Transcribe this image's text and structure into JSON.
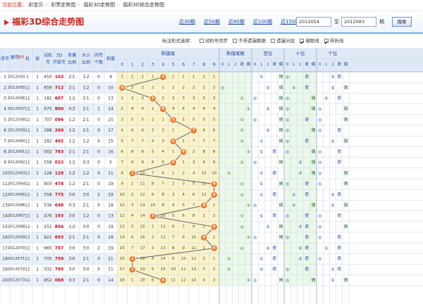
{
  "breadcrumb": {
    "label": "当前位置：",
    "items": [
      "彩宝贝",
      "彩票走势图",
      "福彩3D走势图",
      "福彩3D综合走势图"
    ]
  },
  "title": "福彩3D综合走势图",
  "periods": [
    "近30期",
    "近50期",
    "近80期",
    "近100期",
    "近150期"
  ],
  "range": {
    "from": "2012054",
    "to": "2012083",
    "to_label": "至",
    "qi_label": "期",
    "search": "搜索"
  },
  "options": {
    "label": "标注形式选择：",
    "items": [
      {
        "label": "试机号同步",
        "checked": false
      },
      {
        "label": "不带遗漏数据",
        "checked": false
      },
      {
        "label": "遗漏分层",
        "checked": false
      },
      {
        "label": "辅助线",
        "checked": true
      },
      {
        "label": "带折线",
        "checked": true
      }
    ]
  },
  "headers": {
    "seq": "序号",
    "period": "期号",
    "sort": "排序",
    "machine": "机",
    "ball": "球",
    "trial": "试机号",
    "prize": "3D开奖号",
    "oddeven": "奇偶比例",
    "bigsmall": "大小比例",
    "same": "同号个数",
    "sum": "和值",
    "sec_sumtail": "和值尾",
    "sec_sumtail_sub": "和值尾数",
    "sec_hund": "百位",
    "sec_ten": "十位",
    "sec_unit": "个位",
    "odd": "奇",
    "even": "偶"
  },
  "digits": [
    "0",
    "1",
    "2",
    "3",
    "4",
    "5",
    "6",
    "7",
    "8",
    "9"
  ],
  "rows": [
    {
      "seq": "1",
      "period": "2012054",
      "m": "1",
      "b": "1",
      "trial": "450",
      "prize": "103",
      "oe": "2∶1",
      "bs": "1∶2",
      "same": "0",
      "sum": "4",
      "tail": 4,
      "miss": [
        "1",
        "1",
        "1",
        "1",
        "",
        "1",
        "1",
        "1",
        "1",
        "1"
      ],
      "tt": "",
      "ht": "①",
      "hp": "偶",
      "tnt": "◎",
      "tp": "奇",
      "ut": "②",
      "up": "奇"
    },
    {
      "seq": "2",
      "period": "2012055",
      "m": "11",
      "b": "1",
      "trial": "659",
      "prize": "712",
      "oe": "2∶1",
      "bs": "1∶2",
      "same": "0",
      "sum": "10",
      "tail": 0,
      "miss": [
        "",
        "2",
        "2",
        "2",
        "1",
        "2",
        "2",
        "2",
        "2",
        "2"
      ],
      "tt": "◎",
      "ht": "②",
      "hp": "偶",
      "tnt": "①",
      "tp": "奇",
      "ut": "②",
      "up": "偶"
    },
    {
      "seq": "3",
      "period": "2012056",
      "m": "11",
      "b": "1",
      "trial": "181",
      "prize": "607",
      "oe": "1∶2",
      "bs": "2∶1",
      "same": "0",
      "sum": "13",
      "tail": 3,
      "miss": [
        "1",
        "3",
        "3",
        "",
        "2",
        "3",
        "3",
        "3",
        "3",
        "3"
      ],
      "tt": "①",
      "ht": "◎",
      "hp": "偶",
      "tnt": "◎",
      "tp": "偶",
      "ut": "①",
      "up": "奇"
    },
    {
      "seq": "4",
      "period": "2012057",
      "m": "11",
      "b": "1",
      "trial": "975",
      "prize": "800",
      "oe": "0∶3",
      "bs": "2∶1",
      "same": "1",
      "sum": "14",
      "tail": 4,
      "miss": [
        "2",
        "4",
        "4",
        "1",
        "",
        "4",
        "4",
        "4",
        "4",
        "4"
      ],
      "tt": "①",
      "ht": "②",
      "hp": "偶",
      "tnt": "◎",
      "tp": "偶",
      "ut": "◎",
      "up": "偶"
    },
    {
      "seq": "5",
      "period": "2012058",
      "m": "11",
      "b": "1",
      "trial": "707",
      "prize": "096",
      "oe": "1∶2",
      "bs": "2∶1",
      "same": "0",
      "sum": "15",
      "tail": 5,
      "miss": [
        "3",
        "5",
        "5",
        "2",
        "1",
        "",
        "5",
        "5",
        "5",
        "5"
      ],
      "tt": "②",
      "ht": "◎",
      "hp": "偶",
      "tnt": "◎",
      "tp": "奇",
      "ut": "◎",
      "up": "偶"
    },
    {
      "seq": "6",
      "period": "2012059",
      "m": "11",
      "b": "1",
      "trial": "288",
      "prize": "269",
      "oe": "1∶2",
      "bs": "2∶1",
      "same": "0",
      "sum": "17",
      "tail": 7,
      "miss": [
        "4",
        "6",
        "6",
        "3",
        "2",
        "1",
        "",
        "6",
        "6",
        "6"
      ],
      "tt": "①",
      "ht": "②",
      "hp": "偶",
      "tnt": "◎",
      "tp": "偶",
      "ut": "◎",
      "up": "奇"
    },
    {
      "seq": "7",
      "period": "2012060",
      "m": "11",
      "b": "1",
      "trial": "282",
      "prize": "492",
      "oe": "1∶2",
      "bs": "1∶2",
      "same": "0",
      "sum": "15",
      "tail": 5,
      "miss": [
        "5",
        "7",
        "7",
        "4",
        "3",
        "",
        "1",
        "7",
        "7",
        "7"
      ],
      "tt": "②",
      "ht": "①",
      "hp": "偶",
      "tnt": "◎",
      "tp": "奇",
      "ut": "②",
      "up": "偶"
    },
    {
      "seq": "8",
      "period": "2012061",
      "m": "11",
      "b": "1",
      "trial": "002",
      "prize": "763",
      "oe": "2∶1",
      "bs": "2∶1",
      "same": "0",
      "sum": "16",
      "tail": 6,
      "miss": [
        "6",
        "8",
        "8",
        "5",
        "4",
        "1",
        "",
        "2",
        "8",
        "8"
      ],
      "tt": "①",
      "ht": "①",
      "hp": "奇",
      "tnt": "◎",
      "tp": "偶",
      "ut": "◎",
      "up": "奇"
    },
    {
      "seq": "9",
      "period": "2012062",
      "m": "11",
      "b": "1",
      "trial": "558",
      "prize": "023",
      "oe": "1∶2",
      "bs": "0∶3",
      "same": "0",
      "sum": "5",
      "tail": 5,
      "miss": [
        "7",
        "9",
        "9",
        "6",
        "5",
        "",
        "1",
        "3",
        "9",
        "9"
      ],
      "tt": "②",
      "ht": "◎",
      "hp": "偶",
      "tnt": "②",
      "tp": "偶",
      "ut": "◎",
      "up": "奇"
    },
    {
      "seq": "10",
      "period": "2012063",
      "m": "11",
      "b": "1",
      "trial": "128",
      "prize": "128",
      "oe": "1∶2",
      "bs": "1∶2",
      "same": "0",
      "sum": "11",
      "tail": 1,
      "miss": [
        "8",
        "",
        "10",
        "7",
        "6",
        "1",
        "2",
        "4",
        "10",
        "10"
      ],
      "tt": "①",
      "ht": "①",
      "hp": "奇",
      "tnt": "②",
      "tp": "偶",
      "ut": "◎",
      "up": "偶"
    },
    {
      "seq": "11",
      "period": "2012064",
      "m": "11",
      "b": "1",
      "trial": "803",
      "prize": "478",
      "oe": "1∶2",
      "bs": "2∶1",
      "same": "0",
      "sum": "19",
      "tail": 9,
      "miss": [
        "9",
        "1",
        "11",
        "8",
        "7",
        "2",
        "3",
        "5",
        "11",
        ""
      ],
      "tt": "◎",
      "ht": "①",
      "hp": "偶",
      "tnt": "◎",
      "tp": "奇",
      "ut": "◎",
      "up": "偶"
    },
    {
      "seq": "12",
      "period": "2012065",
      "m": "11",
      "b": "1",
      "trial": "558",
      "prize": "775",
      "oe": "3∶0",
      "bs": "3∶0",
      "same": "2",
      "sum": "19",
      "tail": 9,
      "miss": [
        "10",
        "2",
        "12",
        "9",
        "8",
        "3",
        "4",
        "6",
        "12",
        ""
      ],
      "tt": "◎",
      "ht": "①",
      "hp": "奇",
      "tnt": "①",
      "tp": "奇",
      "ut": "②",
      "up": "奇"
    },
    {
      "seq": "13",
      "period": "2012066",
      "m": "11",
      "b": "1",
      "trial": "536",
      "prize": "648",
      "oe": "0∶3",
      "bs": "2∶1",
      "same": "0",
      "sum": "18",
      "tail": 8,
      "miss": [
        "11",
        "3",
        "13",
        "10",
        "9",
        "4",
        "5",
        "7",
        "",
        "1"
      ],
      "tt": "②",
      "ht": "◎",
      "hp": "偶",
      "tnt": "①",
      "tp": "偶",
      "ut": "②",
      "up": "偶"
    },
    {
      "seq": "14",
      "period": "2012067",
      "m": "11",
      "b": "1",
      "trial": "476",
      "prize": "193",
      "oe": "3∶0",
      "bs": "1∶2",
      "same": "0",
      "sum": "13",
      "tail": 3,
      "miss": [
        "12",
        "4",
        "14",
        "",
        "10",
        "5",
        "6",
        "8",
        "1",
        "2"
      ],
      "tt": "①",
      "ht": "①",
      "hp": "奇",
      "tnt": "◎",
      "tp": "奇",
      "ut": "◎",
      "up": "奇"
    },
    {
      "seq": "15",
      "period": "2012068",
      "m": "11",
      "b": "1",
      "trial": "251",
      "prize": "856",
      "oe": "1∶2",
      "bs": "3∶0",
      "same": "0",
      "sum": "19",
      "tail": 9,
      "miss": [
        "13",
        "5",
        "15",
        "1",
        "11",
        "6",
        "7",
        "9",
        "2",
        ""
      ],
      "tt": "◎",
      "ht": "②",
      "hp": "偶",
      "tnt": "②",
      "tp": "奇",
      "ut": "◎",
      "up": "偶"
    },
    {
      "seq": "16",
      "period": "2012069",
      "m": "11",
      "b": "1",
      "trial": "921",
      "prize": "693",
      "oe": "2∶1",
      "bs": "2∶1",
      "same": "0",
      "sum": "18",
      "tail": 8,
      "miss": [
        "14",
        "6",
        "16",
        "2",
        "12",
        "7",
        "8",
        "10",
        "",
        "1"
      ],
      "tt": "②",
      "ht": "◎",
      "hp": "偶",
      "tnt": "◎",
      "tp": "奇",
      "ut": "◎",
      "up": "奇"
    },
    {
      "seq": "17",
      "period": "2012070",
      "m": "11",
      "b": "1",
      "trial": "965",
      "prize": "757",
      "oe": "3∶0",
      "bs": "3∶0",
      "same": "2",
      "sum": "19",
      "tail": 9,
      "miss": [
        "15",
        "7",
        "17",
        "3",
        "13",
        "8",
        "9",
        "11",
        "1",
        ""
      ],
      "tt": "◎",
      "ht": "②",
      "hp": "奇",
      "tnt": "②",
      "tp": "奇",
      "ut": "①",
      "up": "奇"
    },
    {
      "seq": "18",
      "period": "2012071",
      "m": "11",
      "b": "1",
      "trial": "705",
      "prize": "759",
      "oe": "3∶0",
      "bs": "2∶1",
      "same": "0",
      "sum": "21",
      "tail": 1,
      "miss": [
        "16",
        "",
        "18",
        "4",
        "14",
        "9",
        "10",
        "12",
        "2",
        "1"
      ],
      "tt": "①",
      "ht": "①",
      "hp": "奇",
      "tnt": "②",
      "tp": "奇",
      "ut": "◎",
      "up": "奇"
    },
    {
      "seq": "19",
      "period": "2012072",
      "m": "11",
      "b": "1",
      "trial": "032",
      "prize": "795",
      "oe": "3∶0",
      "bs": "3∶0",
      "same": "0",
      "sum": "21",
      "tail": 1,
      "miss": [
        "17",
        "",
        "19",
        "5",
        "15",
        "10",
        "11",
        "13",
        "3",
        "2"
      ],
      "tt": "①",
      "ht": "①",
      "hp": "奇",
      "tnt": "◎",
      "tp": "奇",
      "ut": "②",
      "up": "奇"
    },
    {
      "seq": "20",
      "period": "2012073",
      "m": "11",
      "b": "1",
      "trial": "852",
      "prize": "068",
      "oe": "0∶3",
      "bs": "2∶1",
      "same": "0",
      "sum": "14",
      "tail": 4,
      "miss": [
        "18",
        "1",
        "20",
        "6",
        "",
        "11",
        "12",
        "14",
        "4",
        "3"
      ],
      "tt": "①",
      "ht": "◎",
      "hp": "偶",
      "tnt": "◎",
      "tp": "偶",
      "ut": "②",
      "up": "偶"
    }
  ],
  "colors": {
    "prize": "#d0021b",
    "ball": "#f07a2b",
    "line": "#666666",
    "head": "#dfe9f5",
    "sumtail_bg": "#fbf3c8",
    "sub_bg": "#ecf9ea",
    "shade": "#eaf1f9",
    "digit_hl": "#d8281c",
    "text": "#1a47a8"
  }
}
